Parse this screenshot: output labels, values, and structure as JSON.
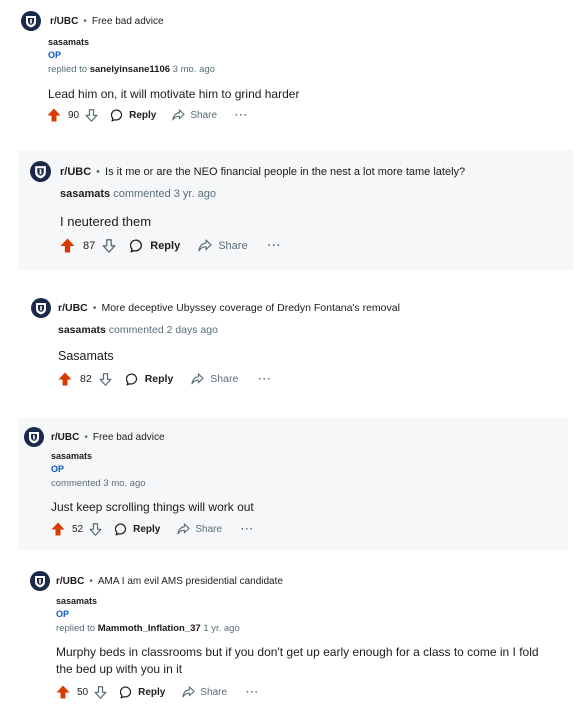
{
  "comments": [
    {
      "subreddit": "r/UBC",
      "separator": "•",
      "post_title": "Free bad advice",
      "author": "sasamats",
      "op_label": "OP",
      "meta_prefix": "replied to",
      "meta_user": "sanelyinsane1106",
      "meta_time": "3 mo. ago",
      "body": "Lead him on, it will motivate him to grind harder",
      "votes": "90",
      "reply_label": "Reply",
      "share_label": "Share",
      "more_label": "···"
    },
    {
      "subreddit": "r/UBC",
      "separator": "•",
      "post_title": "Is it me or are the NEO financial people in the nest a lot more tame lately?",
      "author": "sasamats",
      "meta_text": "commented 3 yr. ago",
      "body": "I neutered them",
      "votes": "87",
      "reply_label": "Reply",
      "share_label": "Share",
      "more_label": "···"
    },
    {
      "subreddit": "r/UBC",
      "separator": "•",
      "post_title": "More deceptive Ubyssey coverage of Dredyn Fontana's removal",
      "author": "sasamats",
      "meta_text": "commented 2 days ago",
      "body": "Sasamats",
      "votes": "82",
      "reply_label": "Reply",
      "share_label": "Share",
      "more_label": "···"
    },
    {
      "subreddit": "r/UBC",
      "separator": "•",
      "post_title": "Free bad advice",
      "author": "sasamats",
      "op_label": "OP",
      "meta_text": "commented 3 mo. ago",
      "body": "Just keep scrolling things will work out",
      "votes": "52",
      "reply_label": "Reply",
      "share_label": "Share",
      "more_label": "···"
    },
    {
      "subreddit": "r/UBC",
      "separator": "•",
      "post_title": "AMA I am evil AMS presidential candidate",
      "author": "sasamats",
      "op_label": "OP",
      "meta_prefix": "replied to",
      "meta_user": "Mammoth_Inflation_37",
      "meta_time": "1 yr. ago",
      "body": "Murphy beds in classrooms but if you don't get up early enough for a class to come in I fold the bed up with you in it",
      "votes": "50",
      "reply_label": "Reply",
      "share_label": "Share",
      "more_label": "···"
    }
  ],
  "colors": {
    "upvote": "#d93a00",
    "op_blue": "#0a56c4",
    "muted": "#576f76",
    "card_alt": "#f6f7f8",
    "avatar_bg": "#1b2a4a"
  },
  "icons": {
    "avatar": "ubc-crest-icon",
    "upvote": "upvote-arrow-icon",
    "downvote": "downvote-arrow-icon",
    "reply": "speech-bubble-icon",
    "share": "share-arrow-icon",
    "more": "ellipsis-icon"
  }
}
